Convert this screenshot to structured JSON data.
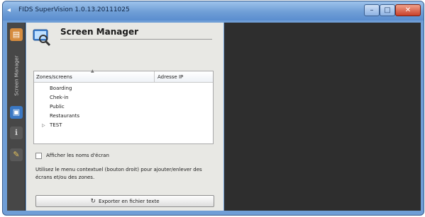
{
  "window": {
    "title": "FIDS SuperVision 1.0.13.20111025",
    "buttons": {
      "minimize": "–",
      "maximize": "□",
      "close": "✕"
    }
  },
  "sidebar": {
    "label": "Screen Manager",
    "icons": [
      "folder-icon",
      "screen-icon",
      "info-icon",
      "wrench-icon"
    ]
  },
  "panel": {
    "title": "Screen Manager",
    "tree": {
      "columns": [
        "Zones/screens",
        "Adresse IP"
      ],
      "rows": [
        {
          "label": "Boarding",
          "expandable": false
        },
        {
          "label": "Chek-in",
          "expandable": false
        },
        {
          "label": "Public",
          "expandable": false
        },
        {
          "label": "Restaurants",
          "expandable": false
        },
        {
          "label": "TEST",
          "expandable": true
        }
      ]
    },
    "show_names_label": "Afficher les noms d'écran",
    "help_text": "Utilisez le menu contextuel (bouton droit) pour ajouter/enlever des écrans et/ou des zones.",
    "export_button": "Exporter en fichier texte"
  },
  "colors": {
    "titlebar": "#6f9ed6",
    "panel_bg": "#e8e8e4",
    "sidebar_bg": "#474747",
    "content_bg": "#2e2e2e"
  }
}
